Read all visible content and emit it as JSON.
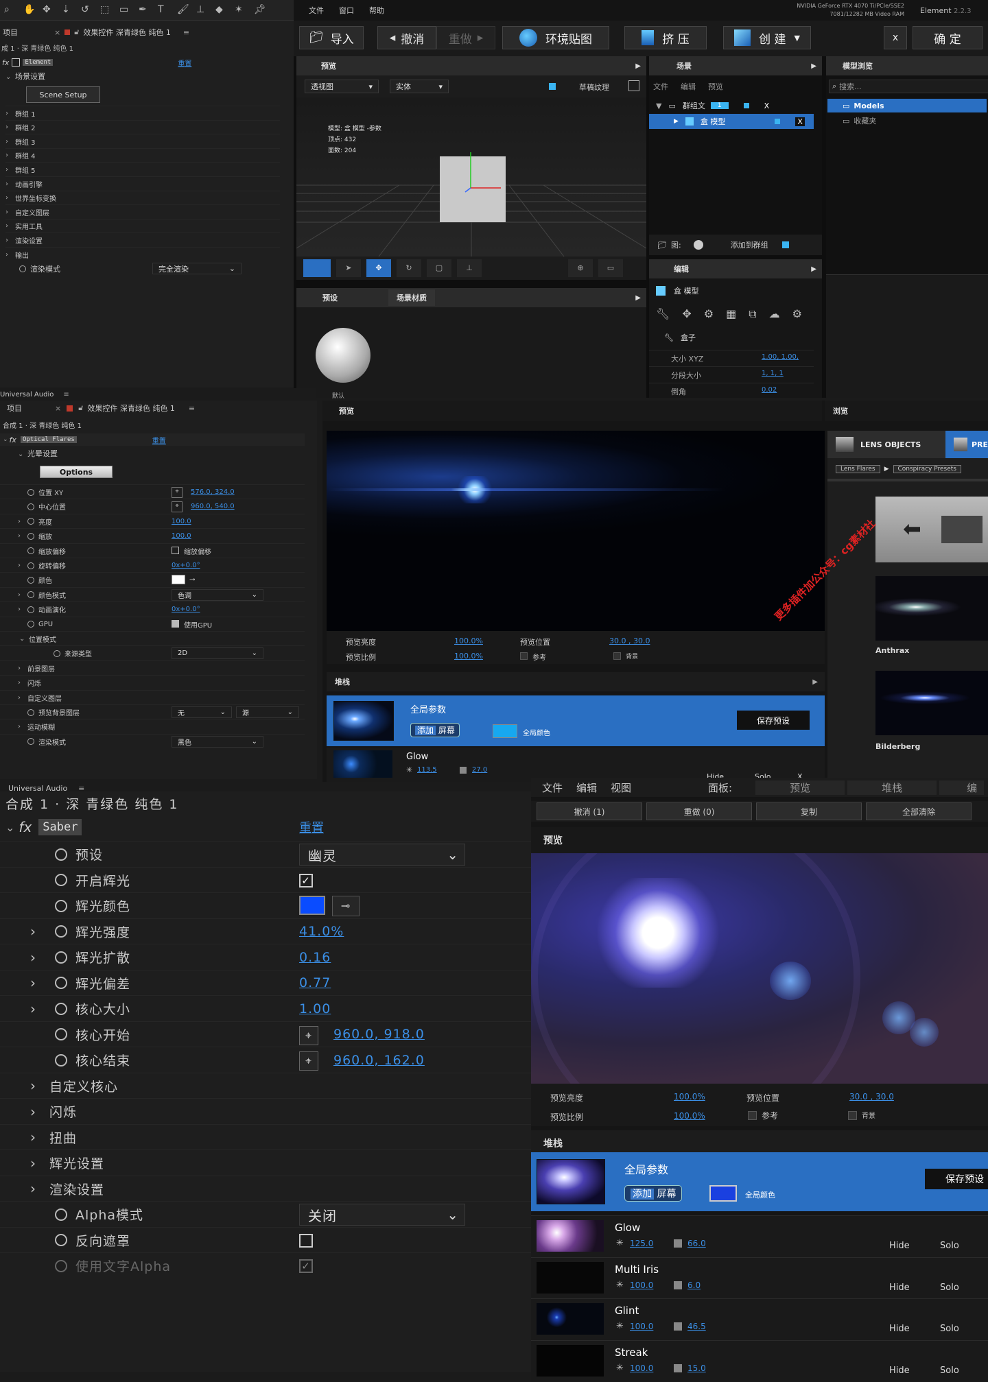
{
  "colors": {
    "accent": "#2a6fc2",
    "link": "#3b8fe6",
    "panel": "#1e1e1e",
    "dark": "#111111"
  },
  "p1": {
    "tools": [
      "search-icon",
      "hand-icon",
      "move-icon",
      "zoom-icon",
      "rotate-icon",
      "select-icon",
      "rect-icon",
      "pen-icon",
      "text-icon",
      "brush-icon",
      "stamp-icon",
      "eraser-icon",
      "puppet-icon",
      "pin-icon"
    ],
    "tab_project": "项目",
    "tab_effect": "效果控件 深青绿色 纯色 1",
    "breadcrumb": "成 1 · 深 青绿色 纯色 1",
    "effect_name": "Element",
    "reset": "重置",
    "scene_group": "场景设置",
    "scene_setup_btn": "Scene Setup",
    "rows": [
      "群组 1",
      "群组 2",
      "群组 3",
      "群组 4",
      "群组 5",
      "动画引擎",
      "世界坐标变换",
      "自定义图层",
      "实用工具",
      "渲染设置",
      "输出"
    ],
    "render_mode_label": "渲染模式",
    "render_mode_value": "完全渲染"
  },
  "el": {
    "menu": [
      "文件",
      "窗口",
      "帮助"
    ],
    "gpu1": "NVIDIA GeForce RTX 4070 Ti/PCIe/SSE2",
    "gpu2": "7081/12282 MB Video RAM",
    "version_label": "Element",
    "version": "2.2.3",
    "toolbar": {
      "import": "导入",
      "undo": "撤消",
      "redo": "重做",
      "env": "环境贴图",
      "extrude": "挤 压",
      "create": "创 建",
      "close": "x",
      "ok": "确 定"
    },
    "preview": {
      "title": "预览",
      "view": "透视图",
      "shading": "实体",
      "draft": "草稿纹理",
      "info_model": "模型: 盒 模型 -参数",
      "info_verts": "顶点: 432",
      "info_faces": "面数: 204"
    },
    "scene": {
      "title": "场景",
      "menu": [
        "文件",
        "编辑",
        "预览"
      ],
      "group": "群组文",
      "group_badge": "1",
      "item": "盒 模型",
      "x": "X",
      "fig_label": "图:",
      "add_group": "添加到群组"
    },
    "models": {
      "title": "模型浏览",
      "search": "搜索...",
      "items": [
        "Models",
        "收藏夹"
      ]
    },
    "presets": {
      "tabs": [
        "预设",
        "场景材质"
      ],
      "caption": "默认"
    },
    "edit": {
      "title": "编辑",
      "object": "盒 模型",
      "section": "盒子",
      "props": [
        {
          "label": "大小 XYZ",
          "value": "1.00, 1.00,"
        },
        {
          "label": "分段大小",
          "value": "1, 1, 1"
        },
        {
          "label": "倒角",
          "value": "0.02"
        }
      ]
    }
  },
  "ua1": "Universal Audio",
  "p3": {
    "tab_project": "项目",
    "tab_effect": "效果控件 深青绿色 纯色 1",
    "breadcrumb": "合成 1 · 深 青绿色 纯色 1",
    "effect_name": "Optical Flares",
    "reset": "重置",
    "options_group": "光晕设置",
    "options_btn": "Options",
    "rows": [
      {
        "t": "v",
        "label": "位置 XY",
        "value": "576.0, 324.0",
        "tgt": true
      },
      {
        "t": "v",
        "label": "中心位置",
        "value": "960.0, 540.0",
        "tgt": true
      },
      {
        "t": "v",
        "label": "亮度",
        "value": "100.0",
        "exp": true
      },
      {
        "t": "v",
        "label": "缩放",
        "value": "100.0",
        "exp": true
      },
      {
        "t": "c",
        "label": "缩放偏移",
        "value": "缩放偏移"
      },
      {
        "t": "v",
        "label": "旋转偏移",
        "value": "0x+0.0°",
        "exp": true
      },
      {
        "t": "col",
        "label": "颜色"
      },
      {
        "t": "s",
        "label": "颜色模式",
        "value": "色调",
        "exp": true
      },
      {
        "t": "v",
        "label": "动画演化",
        "value": "0x+0.0°",
        "exp": true
      },
      {
        "t": "c",
        "label": "GPU",
        "value": "使用GPU",
        "checked": true
      },
      {
        "t": "g",
        "label": "位置模式"
      },
      {
        "t": "s",
        "label": "来源类型",
        "value": "2D",
        "indent": true
      },
      {
        "t": "g2",
        "label": "前景图层"
      },
      {
        "t": "g2",
        "label": "闪烁"
      },
      {
        "t": "g2",
        "label": "自定义图层"
      },
      {
        "t": "ss",
        "label": "预览背景图层",
        "value": "无",
        "value2": "源"
      },
      {
        "t": "g2",
        "label": "运动模糊"
      },
      {
        "t": "s",
        "label": "渲染模式",
        "value": "黑色"
      }
    ]
  },
  "of": {
    "preview_title": "预览",
    "params": [
      {
        "label": "预览亮度",
        "value": "100.0%"
      },
      {
        "label": "预览比例",
        "value": "100.0%"
      },
      {
        "label": "预览位置",
        "value": "30.0 , 30.0"
      }
    ],
    "ref": "参考",
    "bg": "背景",
    "stack_title": "堆栈",
    "global": "全局参数",
    "add": "添加",
    "screen": "屏幕",
    "global_color": "全局颜色",
    "save_preset": "保存预设",
    "glow": "Glow",
    "glow_b": "113.5",
    "glow_s": "27.0",
    "hide": "Hide",
    "solo": "Solo",
    "x": "X",
    "browser_title": "浏览",
    "lens_objects": "LENS OBJECTS",
    "pre_tab": "PRE",
    "crumb": [
      "Lens Flares",
      "Conspiracy Presets"
    ],
    "thumbs": [
      "Anthrax",
      "Bilderberg"
    ],
    "watermark": "更多插件加公众号：cg素材社"
  },
  "ua2": "Universal Audio",
  "saber": {
    "breadcrumb": "合成 1 · 深 青绿色 纯色 1",
    "effect_name": "Saber",
    "reset": "重置",
    "rows": [
      {
        "t": "s",
        "label": "预设",
        "value": "幽灵"
      },
      {
        "t": "c",
        "label": "开启辉光",
        "checked": true
      },
      {
        "t": "col",
        "label": "辉光颜色"
      },
      {
        "t": "v",
        "label": "辉光强度",
        "value": "41.0%",
        "exp": true
      },
      {
        "t": "v",
        "label": "辉光扩散",
        "value": "0.16",
        "exp": true
      },
      {
        "t": "v",
        "label": "辉光偏差",
        "value": "0.77",
        "exp": true
      },
      {
        "t": "v",
        "label": "核心大小",
        "value": "1.00",
        "exp": true
      },
      {
        "t": "p",
        "label": "核心开始",
        "value": "960.0, 918.0"
      },
      {
        "t": "p",
        "label": "核心结束",
        "value": "960.0, 162.0"
      },
      {
        "t": "g",
        "label": "自定义核心"
      },
      {
        "t": "g",
        "label": "闪烁"
      },
      {
        "t": "g",
        "label": "扭曲"
      },
      {
        "t": "g",
        "label": "辉光设置"
      },
      {
        "t": "g",
        "label": "渲染设置"
      },
      {
        "t": "s",
        "label": "Alpha模式",
        "value": "关闭"
      },
      {
        "t": "c",
        "label": "反向遮罩",
        "checked": false
      },
      {
        "t": "c",
        "label": "使用文字Alpha",
        "checked": true,
        "dim": true
      }
    ]
  },
  "of2": {
    "menu": [
      "文件",
      "编辑",
      "视图"
    ],
    "panel_label": "面板:",
    "panel_tabs": [
      "预览",
      "堆栈",
      "编"
    ],
    "buttons": [
      "撤消 (1)",
      "重做 (0)",
      "复制",
      "全部清除"
    ],
    "preview_title": "预览",
    "params": [
      {
        "label": "预览亮度",
        "value": "100.0%"
      },
      {
        "label": "预览比例",
        "value": "100.0%"
      },
      {
        "label": "预览位置",
        "value": "30.0 , 30.0"
      }
    ],
    "ref": "参考",
    "bg": "背景",
    "stack_title": "堆栈",
    "global": "全局参数",
    "add": "添加",
    "screen": "屏幕",
    "global_color": "全局颜色",
    "save_preset": "保存预设",
    "layers": [
      {
        "name": "Glow",
        "b": "125.0",
        "s": "66.0"
      },
      {
        "name": "Multi Iris",
        "b": "100.0",
        "s": "6.0"
      },
      {
        "name": "Glint",
        "b": "100.0",
        "s": "46.5"
      },
      {
        "name": "Streak",
        "b": "100.0",
        "s": "15.0"
      }
    ],
    "hide": "Hide",
    "solo": "Solo"
  }
}
